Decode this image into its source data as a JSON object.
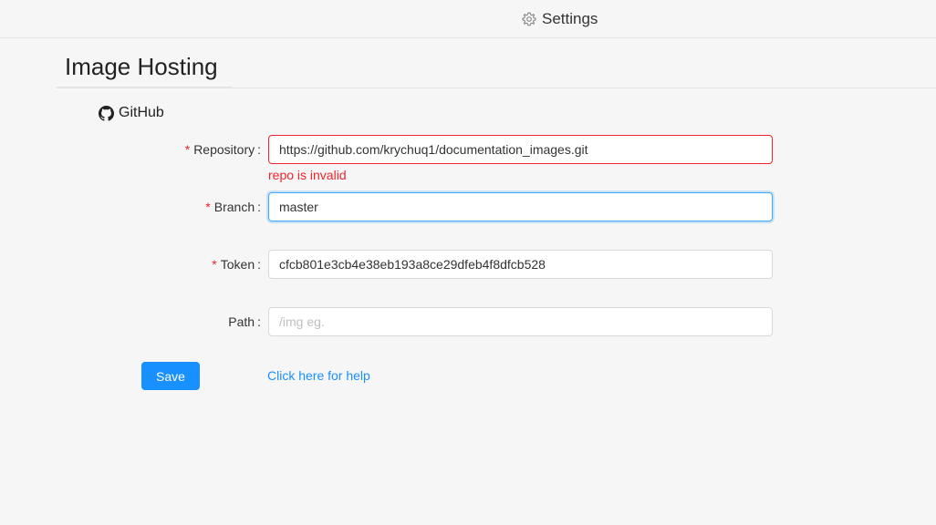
{
  "header": {
    "title": "Settings",
    "icon": "gear-icon"
  },
  "section": {
    "title": "Image Hosting"
  },
  "provider": {
    "name": "GitHub",
    "icon": "github-icon"
  },
  "form": {
    "repository": {
      "label": "Repository",
      "required": true,
      "value": "https://github.com/krychuq1/documentation_images.git",
      "error": "repo is invalid"
    },
    "branch": {
      "label": "Branch",
      "required": true,
      "value": "master"
    },
    "token": {
      "label": "Token",
      "required": true,
      "value": "cfcb801e3cb4e38eb193a8ce29dfeb4f8dfcb528"
    },
    "path": {
      "label": "Path",
      "required": false,
      "value": "",
      "placeholder": "/img eg."
    },
    "required_marker": "*",
    "colon": ":"
  },
  "actions": {
    "save_label": "Save",
    "help_label": "Click here for help"
  },
  "colors": {
    "primary": "#1890ff",
    "error": "#f5222d"
  }
}
